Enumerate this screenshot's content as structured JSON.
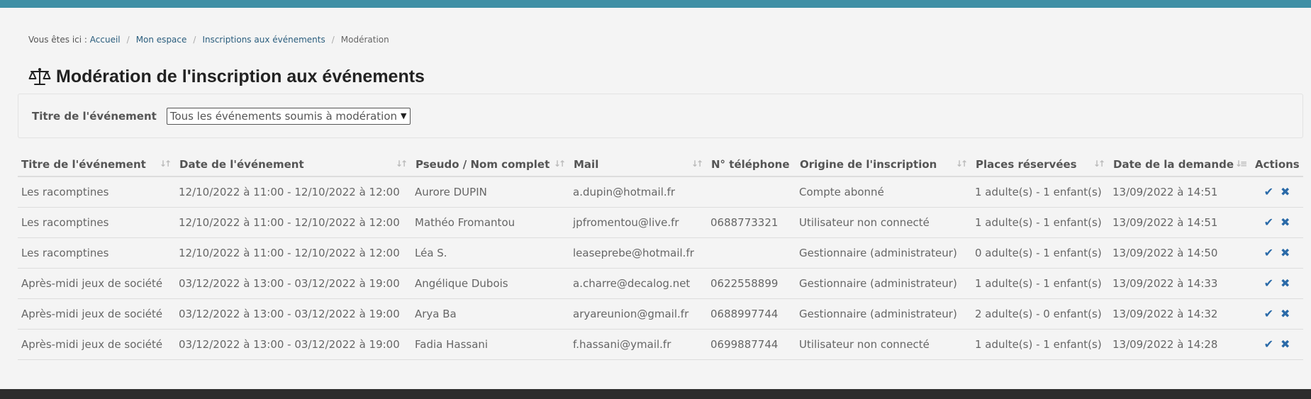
{
  "breadcrumb": {
    "prefix": "Vous êtes ici :",
    "items": [
      "Accueil",
      "Mon espace",
      "Inscriptions aux événements"
    ],
    "current": "Modération"
  },
  "page": {
    "title": "Modération de l'inscription aux événements",
    "icon": "balance-scale-icon"
  },
  "filter": {
    "label": "Titre de l'événement",
    "selected": "Tous les événements soumis à modération"
  },
  "table": {
    "columns": [
      "Titre de l'événement",
      "Date de l'événement",
      "Pseudo / Nom complet",
      "Mail",
      "N° téléphone",
      "Origine de l'inscription",
      "Places réservées",
      "Date de la demande",
      "Actions"
    ],
    "rows": [
      [
        "Les racomptines",
        "12/10/2022 à 11:00 - 12/10/2022 à 12:00",
        "Aurore DUPIN",
        "a.dupin@hotmail.fr",
        "",
        "Compte abonné",
        "1 adulte(s) - 1 enfant(s)",
        "13/09/2022 à 14:51"
      ],
      [
        "Les racomptines",
        "12/10/2022 à 11:00 - 12/10/2022 à 12:00",
        "Mathéo Fromantou",
        "jpfromentou@live.fr",
        "0688773321",
        "Utilisateur non connecté",
        "1 adulte(s) - 1 enfant(s)",
        "13/09/2022 à 14:51"
      ],
      [
        "Les racomptines",
        "12/10/2022 à 11:00 - 12/10/2022 à 12:00",
        "Léa S.",
        "leaseprebe@hotmail.fr",
        "",
        "Gestionnaire (administrateur)",
        "0 adulte(s) - 1 enfant(s)",
        "13/09/2022 à 14:50"
      ],
      [
        "Après-midi jeux de société",
        "03/12/2022 à 13:00 - 03/12/2022 à 19:00",
        "Angélique Dubois",
        "a.charre@decalog.net",
        "0622558899",
        "Gestionnaire (administrateur)",
        "1 adulte(s) - 1 enfant(s)",
        "13/09/2022 à 14:33"
      ],
      [
        "Après-midi jeux de société",
        "03/12/2022 à 13:00 - 03/12/2022 à 19:00",
        "Arya Ba",
        "aryareunion@gmail.fr",
        "0688997744",
        "Gestionnaire (administrateur)",
        "2 adulte(s) - 0 enfant(s)",
        "13/09/2022 à 14:32"
      ],
      [
        "Après-midi jeux de société",
        "03/12/2022 à 13:00 - 03/12/2022 à 19:00",
        "Fadia Hassani",
        "f.hassani@ymail.fr",
        "0699887744",
        "Utilisateur non connecté",
        "1 adulte(s) - 1 enfant(s)",
        "13/09/2022 à 14:28"
      ]
    ],
    "actions": {
      "approve_glyph": "✔",
      "reject_glyph": "✖"
    }
  },
  "colors": {
    "top_bar": "#3f8fa5",
    "link": "#2a5d7d",
    "action": "#2a6aa8",
    "footer": "#2c2c2c"
  }
}
